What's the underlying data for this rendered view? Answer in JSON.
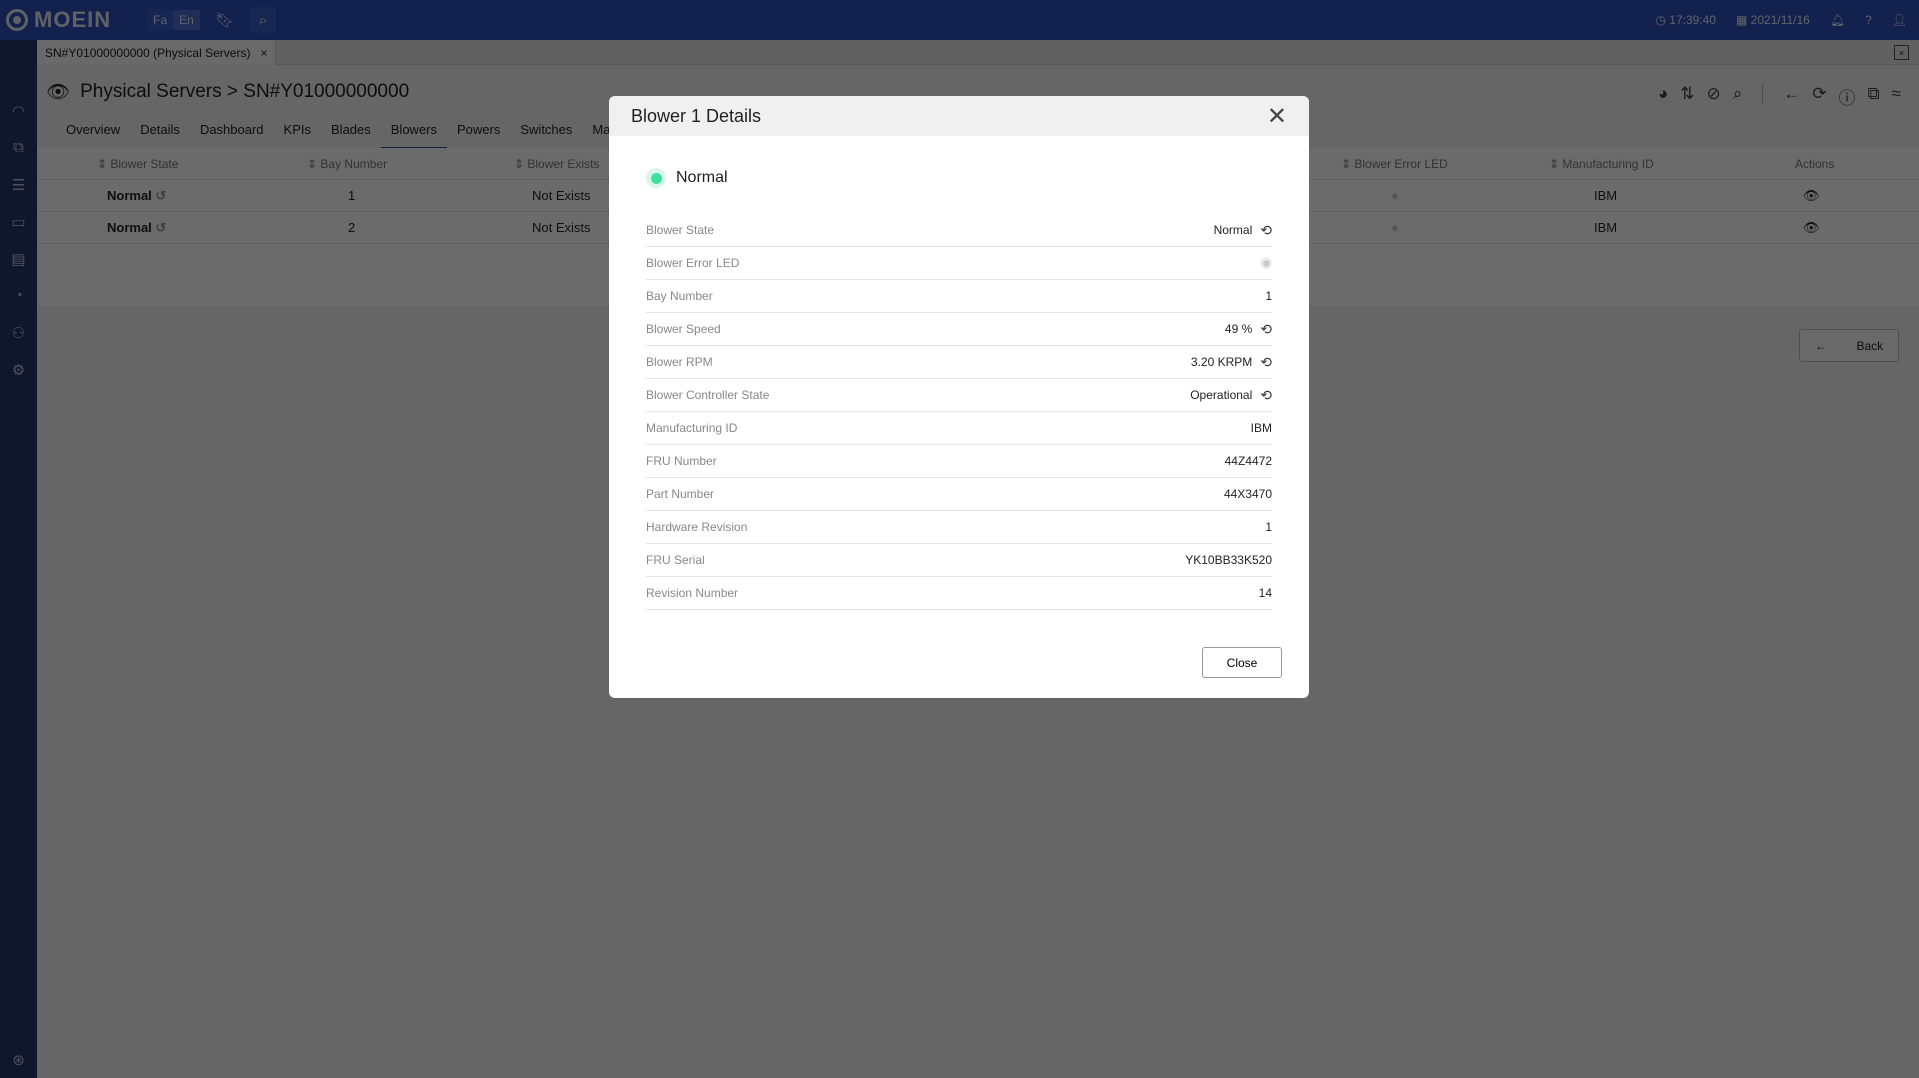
{
  "app": {
    "logo": "MOEIN",
    "lang": [
      "Fa",
      "En"
    ],
    "time": "17:39:40",
    "date": "2021/11/16"
  },
  "tab": {
    "label": "SN#Y01000000000 (Physical Servers)"
  },
  "page": {
    "title": "Physical Servers > SN#Y01000000000",
    "back_label": "Back"
  },
  "navtabs": [
    "Overview",
    "Details",
    "Dashboard",
    "KPIs",
    "Blades",
    "Blowers",
    "Powers",
    "Switches",
    "Manage"
  ],
  "table": {
    "headers": [
      "Blower State",
      "Bay Number",
      "Blower Exists",
      "Blower Error LED",
      "Manufacturing ID",
      "Actions"
    ],
    "rows": [
      {
        "state": "Normal",
        "bay": "1",
        "exists": "Not Exists",
        "mfg": "IBM"
      },
      {
        "state": "Normal",
        "bay": "2",
        "exists": "Not Exists",
        "mfg": "IBM"
      }
    ]
  },
  "modal": {
    "title": "Blower 1 Details",
    "status": "Normal",
    "status_color": "#3ee0a0",
    "close_label": "Close",
    "fields": [
      {
        "label": "Blower State",
        "value": "Normal",
        "history": true
      },
      {
        "label": "Blower Error LED",
        "value": "",
        "led": true
      },
      {
        "label": "Bay Number",
        "value": "1"
      },
      {
        "label": "Blower Speed",
        "value": "49 %",
        "history": true
      },
      {
        "label": "Blower RPM",
        "value": "3.20 KRPM",
        "history": true
      },
      {
        "label": "Blower Controller State",
        "value": "Operational",
        "history": true
      },
      {
        "label": "Manufacturing ID",
        "value": "IBM"
      },
      {
        "label": "FRU Number",
        "value": "44Z4472"
      },
      {
        "label": "Part Number",
        "value": "44X3470"
      },
      {
        "label": "Hardware Revision",
        "value": "1"
      },
      {
        "label": "FRU Serial",
        "value": "YK10BB33K520"
      },
      {
        "label": "Revision Number",
        "value": "14"
      }
    ]
  }
}
